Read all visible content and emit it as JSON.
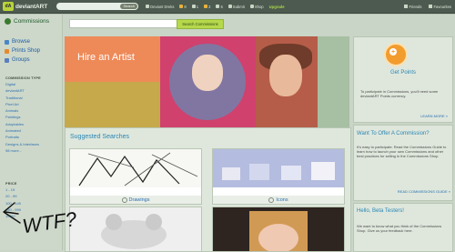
{
  "topbar": {
    "logo_mark": "dA",
    "logo_text": "deviantART",
    "search_button": "Search",
    "nav": [
      {
        "label": "Deviant Dreks",
        "color": "#c9d6c6"
      },
      {
        "label": "8",
        "color": "#e8b23a"
      },
      {
        "label": "1",
        "color": "#c9d6c6"
      },
      {
        "label": "2",
        "color": "#e8b23a"
      },
      {
        "label": "5",
        "color": "#c9d6c6"
      },
      {
        "label": "Submit",
        "color": "#c9d6c6"
      },
      {
        "label": "Shop",
        "color": "#c9d6c6"
      }
    ],
    "upgrade": "Upgrade",
    "friends": "Friends",
    "favourites": "Favourites"
  },
  "sidebar": {
    "title": "Commissions",
    "nav": [
      {
        "label": "Browse",
        "color": "#4a86c5"
      },
      {
        "label": "Prints Shop",
        "color": "#e68a2e"
      },
      {
        "label": "Groups",
        "color": "#5a7fbf"
      }
    ],
    "commission_type_heading": "COMMISSION TYPE",
    "commission_types": [
      "Digital",
      "deviantART",
      "Traditional",
      "Pixel Art",
      "Animals",
      "Paintings",
      "Adoptables",
      "Animated",
      "Portraits",
      "Designs & Interfaces",
      "98 more..."
    ],
    "price_heading": "PRICE",
    "prices": [
      "1 - 19",
      "20 - 99",
      "100 - 149",
      "150 - 999",
      "1000+"
    ]
  },
  "commission_search": {
    "placeholder": "",
    "button": "Search Commissions"
  },
  "hero": {
    "label": "Hire an Artist"
  },
  "get_points": {
    "title": "Get Points",
    "text": "To participate in Commissions, you'll need some deviantART Points currency.",
    "link": "LEARN MORE »"
  },
  "suggested": {
    "title": "Suggested Searches",
    "cards": [
      {
        "label": "Drawings"
      },
      {
        "label": "Icons"
      }
    ]
  },
  "offer": {
    "title": "Want To Offer A Commission?",
    "text": "It's easy to participate. Read the Commissions Guide to learn how to launch your own Commissions and other best practices for selling in the Commissions Shop.",
    "link": "READ COMMISSIONS GUIDE »"
  },
  "beta": {
    "title": "Hello, Beta Testers!",
    "text": "We want to know what you think of the Commissions Shop. Give us your feedback here."
  },
  "annotation": {
    "text": "WTF?"
  }
}
